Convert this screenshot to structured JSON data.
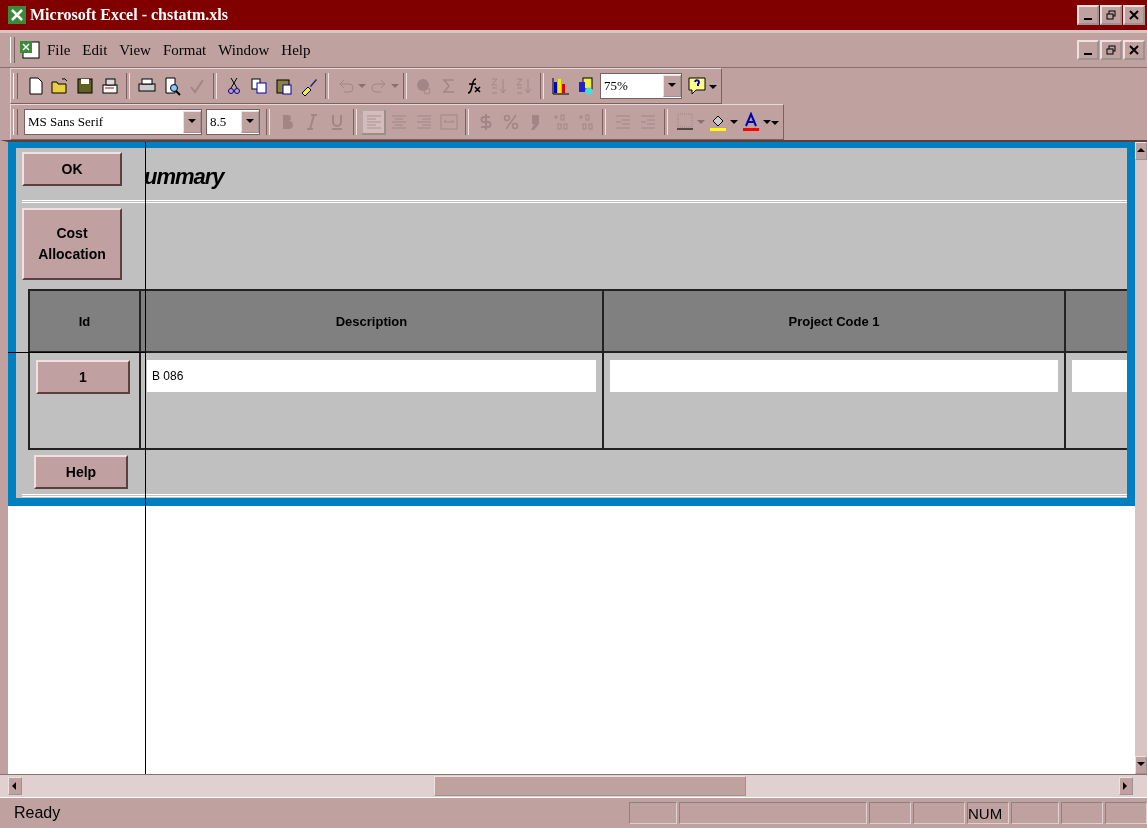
{
  "window": {
    "title": "Microsoft Excel - chstatm.xls"
  },
  "menu": [
    {
      "label": "File"
    },
    {
      "label": "Edit"
    },
    {
      "label": "View"
    },
    {
      "label": "Format"
    },
    {
      "label": "Window"
    },
    {
      "label": "Help"
    }
  ],
  "standard_toolbar": {
    "groups": [
      [
        {
          "kind": "new",
          "disabled": false
        },
        {
          "kind": "open",
          "disabled": false
        },
        {
          "kind": "save",
          "disabled": false
        },
        {
          "kind": "mail",
          "disabled": false
        }
      ],
      [
        {
          "kind": "print",
          "disabled": false
        },
        {
          "kind": "preview",
          "disabled": false
        },
        {
          "kind": "spelling",
          "disabled": true
        }
      ],
      [
        {
          "kind": "cut",
          "disabled": false
        },
        {
          "kind": "copy",
          "disabled": false
        },
        {
          "kind": "paste",
          "disabled": false
        },
        {
          "kind": "brush",
          "disabled": false
        }
      ],
      [
        {
          "kind": "undo",
          "disabled": true
        },
        {
          "kind": "redo",
          "disabled": true
        }
      ],
      [
        {
          "kind": "web",
          "disabled": true
        },
        {
          "kind": "sum",
          "disabled": true
        },
        {
          "kind": "function",
          "disabled": false
        },
        {
          "kind": "sort-asc",
          "disabled": true
        },
        {
          "kind": "sort-desc",
          "disabled": true
        }
      ],
      [
        {
          "kind": "chart",
          "disabled": false
        },
        {
          "kind": "map",
          "disabled": false
        }
      ]
    ],
    "zoom": "75%"
  },
  "formatting_toolbar": {
    "font": "MS Sans Serif",
    "size": "8.5",
    "groups": [
      [
        {
          "kind": "bold",
          "disabled": true,
          "selected": false
        },
        {
          "kind": "italic",
          "disabled": true,
          "selected": false
        },
        {
          "kind": "underline",
          "disabled": true,
          "selected": false
        }
      ],
      [
        {
          "kind": "align-left",
          "disabled": true,
          "selected": true
        },
        {
          "kind": "align-center",
          "disabled": true,
          "selected": false
        },
        {
          "kind": "align-right",
          "disabled": true,
          "selected": false
        },
        {
          "kind": "merge",
          "disabled": true,
          "selected": false
        }
      ],
      [
        {
          "kind": "currency",
          "disabled": true,
          "selected": false
        },
        {
          "kind": "percent",
          "disabled": true,
          "selected": false
        },
        {
          "kind": "comma",
          "disabled": true,
          "selected": false
        },
        {
          "kind": "decimal-more",
          "disabled": true,
          "selected": false
        },
        {
          "kind": "decimal-less",
          "disabled": true,
          "selected": false
        }
      ],
      [
        {
          "kind": "indent-less",
          "disabled": true,
          "selected": false
        },
        {
          "kind": "indent-more",
          "disabled": true,
          "selected": false
        }
      ],
      [
        {
          "kind": "borders",
          "disabled": true,
          "selected": false
        },
        {
          "kind": "fill",
          "disabled": false,
          "selected": false
        },
        {
          "kind": "font-color",
          "disabled": false,
          "selected": false
        }
      ]
    ]
  },
  "form": {
    "ok_button": "OK",
    "title": "ummary",
    "cost_button": "Cost Allocation",
    "columns": [
      {
        "label": "Id"
      },
      {
        "label": "Description"
      },
      {
        "label": "Project Code 1"
      },
      {}
    ],
    "rows": [
      {
        "id": "1",
        "fields": [
          "B 086"
        ]
      }
    ],
    "help_button": "Help"
  },
  "status_bar": {
    "text": "Ready",
    "indicator": "NUM"
  }
}
